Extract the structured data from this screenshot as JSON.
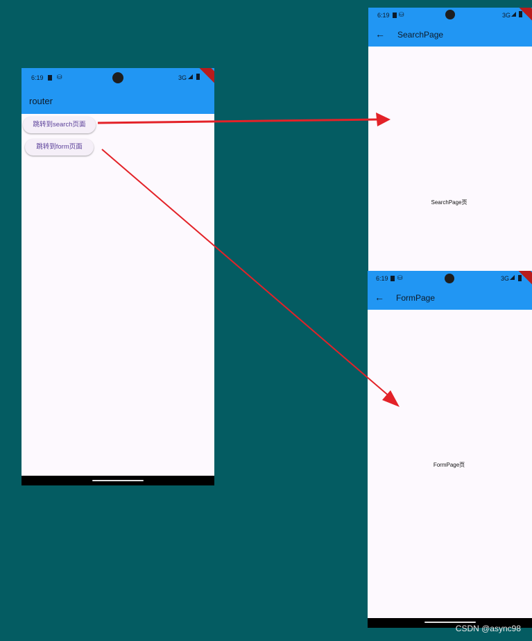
{
  "colors": {
    "background": "#045c62",
    "appbar": "#2196f3",
    "arrow": "#e32228",
    "page": "#fdf9fe"
  },
  "main_phone": {
    "time": "6:19",
    "network": "3G",
    "title": "router",
    "buttons": [
      {
        "label": "跳转到search页面"
      },
      {
        "label": "跳转到form页面"
      }
    ]
  },
  "search_phone": {
    "time": "6:19",
    "network": "3G",
    "title": "SearchPage",
    "body_text": "SearchPage页"
  },
  "form_phone": {
    "time": "6:19",
    "network": "3G",
    "title": "FormPage",
    "body_text": "FormPage页"
  },
  "icons": [
    "sim-card-icon",
    "notification-icon",
    "camera-cutout-icon",
    "signal-icon",
    "battery-icon",
    "back-arrow-icon",
    "debug-banner-icon"
  ],
  "watermark": "CSDN @async98"
}
